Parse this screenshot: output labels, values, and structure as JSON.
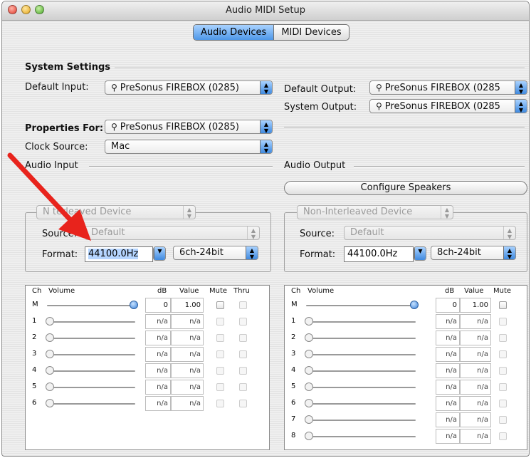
{
  "window": {
    "title": "Audio MIDI Setup"
  },
  "tabs": [
    {
      "label": "Audio Devices",
      "active": true
    },
    {
      "label": "MIDI Devices",
      "active": false
    }
  ],
  "system_settings": {
    "heading": "System Settings",
    "default_input_label": "Default Input:",
    "default_input_value": "PreSonus FIREBOX (0285)",
    "default_output_label": "Default Output:",
    "default_output_value": "PreSonus FIREBOX (0285",
    "system_output_label": "System Output:",
    "system_output_value": "PreSonus FIREBOX (0285"
  },
  "properties": {
    "label": "Properties For:",
    "value": "PreSonus FIREBOX (0285)",
    "clock_label": "Clock Source:",
    "clock_value": "Mac"
  },
  "audio_input": {
    "heading": "Audio Input",
    "device_mode": "Non-Interleaved Device",
    "device_mode_visible": "N   terleaved Device",
    "source_label": "Source:",
    "source_value": "Default",
    "format_label": "Format:",
    "rate": "44100.0Hz",
    "bits": "6ch-24bit",
    "columns": {
      "ch": "Ch",
      "volume": "Volume",
      "db": "dB",
      "value": "Value",
      "mute": "Mute",
      "thru": "Thru"
    },
    "channels": [
      {
        "ch": "M",
        "db": "0",
        "value": "1.00"
      },
      {
        "ch": "1",
        "db": "n/a",
        "value": "n/a"
      },
      {
        "ch": "2",
        "db": "n/a",
        "value": "n/a"
      },
      {
        "ch": "3",
        "db": "n/a",
        "value": "n/a"
      },
      {
        "ch": "4",
        "db": "n/a",
        "value": "n/a"
      },
      {
        "ch": "5",
        "db": "n/a",
        "value": "n/a"
      },
      {
        "ch": "6",
        "db": "n/a",
        "value": "n/a"
      }
    ]
  },
  "audio_output": {
    "heading": "Audio Output",
    "configure_label": "Configure Speakers",
    "device_mode": "Non-Interleaved Device",
    "source_label": "Source:",
    "source_value": "Default",
    "format_label": "Format:",
    "rate": "44100.0Hz",
    "bits": "8ch-24bit",
    "columns": {
      "ch": "Ch",
      "volume": "Volume",
      "db": "dB",
      "value": "Value",
      "mute": "Mute"
    },
    "channels": [
      {
        "ch": "M",
        "db": "0",
        "value": "1.00"
      },
      {
        "ch": "1",
        "db": "n/a",
        "value": "n/a"
      },
      {
        "ch": "2",
        "db": "n/a",
        "value": "n/a"
      },
      {
        "ch": "3",
        "db": "n/a",
        "value": "n/a"
      },
      {
        "ch": "4",
        "db": "n/a",
        "value": "n/a"
      },
      {
        "ch": "5",
        "db": "n/a",
        "value": "n/a"
      },
      {
        "ch": "6",
        "db": "n/a",
        "value": "n/a"
      },
      {
        "ch": "7",
        "db": "n/a",
        "value": "n/a"
      },
      {
        "ch": "8",
        "db": "n/a",
        "value": "n/a"
      }
    ]
  },
  "colors": {
    "accent": "#4e97e8",
    "annotation_arrow": "#e8231c"
  }
}
